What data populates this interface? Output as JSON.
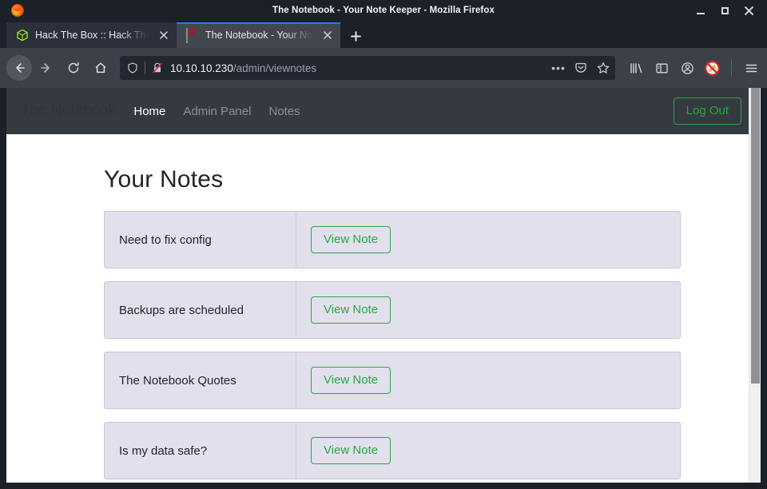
{
  "window": {
    "title": "The Notebook - Your Note Keeper - Mozilla Firefox",
    "controls": {
      "minimize": "minimize-button",
      "maximize": "maximize-button",
      "close": "close-button"
    }
  },
  "browser": {
    "tabs": [
      {
        "title": "Hack The Box :: Hack The",
        "favicon": "htb-cube-icon",
        "active": false
      },
      {
        "title": "The Notebook - Your Not",
        "favicon": "notebook-icon",
        "active": true
      }
    ],
    "new_tab_label": "+",
    "toolbar": {
      "back": "back-button",
      "forward": "forward-button",
      "reload": "reload-button",
      "home": "home-button"
    },
    "urlbar": {
      "host": "10.10.10.230",
      "path": "/admin/viewnotes",
      "shield_icon": "tracking-protection-shield-icon",
      "lock_icon": "insecure-connection-icon",
      "page_actions": [
        "page-actions-ellipsis",
        "save-to-pocket-icon",
        "bookmark-star-icon"
      ]
    },
    "right_icons": [
      "library-icon",
      "sidebar-icon",
      "account-icon",
      "noscript-icon",
      "app-menu-icon"
    ]
  },
  "site": {
    "brand": "The Notebook",
    "nav_links": [
      {
        "label": "Home",
        "active": true
      },
      {
        "label": "Admin Panel",
        "active": false
      },
      {
        "label": "Notes",
        "active": false
      }
    ],
    "logout_label": "Log Out",
    "page_title": "Your Notes",
    "action_label": "View Note",
    "notes": [
      {
        "title": "Need to fix config"
      },
      {
        "title": "Backups are scheduled"
      },
      {
        "title": "The Notebook Quotes"
      },
      {
        "title": "Is my data safe?"
      }
    ]
  },
  "colors": {
    "accent_green": "#28a745",
    "navbar_dark": "#343a40",
    "card_bg": "#e2e0ec",
    "card_border": "#c9c5d9",
    "tab_active_border": "#0a84ff"
  }
}
